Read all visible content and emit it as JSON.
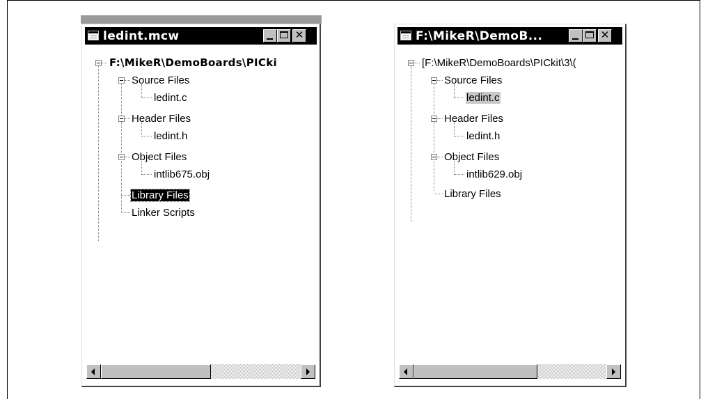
{
  "window_left": {
    "title": "ledint.mcw",
    "controls": {
      "minimize": "minimize-icon",
      "maximize": "maximize-icon",
      "close": "close-icon"
    },
    "tree": {
      "root": "F:\\MikeR\\DemoBoards\\PICki",
      "source_files": "Source Files",
      "source_file_1": "ledint.c",
      "header_files": "Header Files",
      "header_file_1": "ledint.h",
      "object_files": "Object Files",
      "object_file_1": "intlib675.obj",
      "library_files": "Library Files",
      "linker_scripts": "Linker Scripts"
    },
    "selected_item": "Library Files"
  },
  "window_right": {
    "title": "F:\\MikeR\\DemoB...",
    "controls": {
      "minimize": "minimize-icon",
      "maximize": "maximize-icon",
      "close": "close-icon"
    },
    "tree": {
      "root": "[F:\\MikeR\\DemoBoards\\PICkit\\3\\(",
      "source_files": "Source Files",
      "source_file_1": "ledint.c",
      "header_files": "Header Files",
      "header_file_1": "ledint.h",
      "object_files": "Object Files",
      "object_file_1": "intlib629.obj",
      "library_files": "Library Files"
    },
    "selected_item": "ledint.c"
  },
  "colors": {
    "titlebar": "#000000",
    "title_text": "#ffffff",
    "selection_left": "#000000",
    "selection_right": "#c8c8c8",
    "chrome": "#c0c0c0"
  }
}
